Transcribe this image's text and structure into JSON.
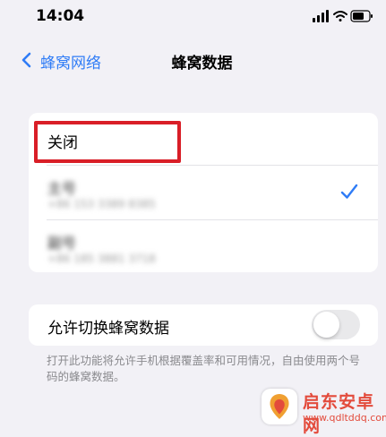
{
  "status_bar": {
    "time": "14:04"
  },
  "nav": {
    "back_label": "蜂窝网络",
    "title": "蜂窝数据"
  },
  "options": {
    "off_label": "关闭",
    "sims": [
      {
        "name": "主号",
        "number": "+86 153 3389 8385",
        "selected": true
      },
      {
        "name": "副号",
        "number": "+86 185 3881 3718",
        "selected": false
      }
    ]
  },
  "switching": {
    "label": "允许切换蜂窝数据",
    "enabled": false
  },
  "footer": {
    "note": "打开此功能将允许手机根据覆盖率和可用情况，自由使用两个号码的蜂窝数据。"
  },
  "watermark": {
    "title": "启东安卓网",
    "url": "www.qdltddq.com"
  },
  "colors": {
    "accent": "#2f7cf6",
    "highlight": "#d91e27",
    "background": "#f2f1f6"
  }
}
